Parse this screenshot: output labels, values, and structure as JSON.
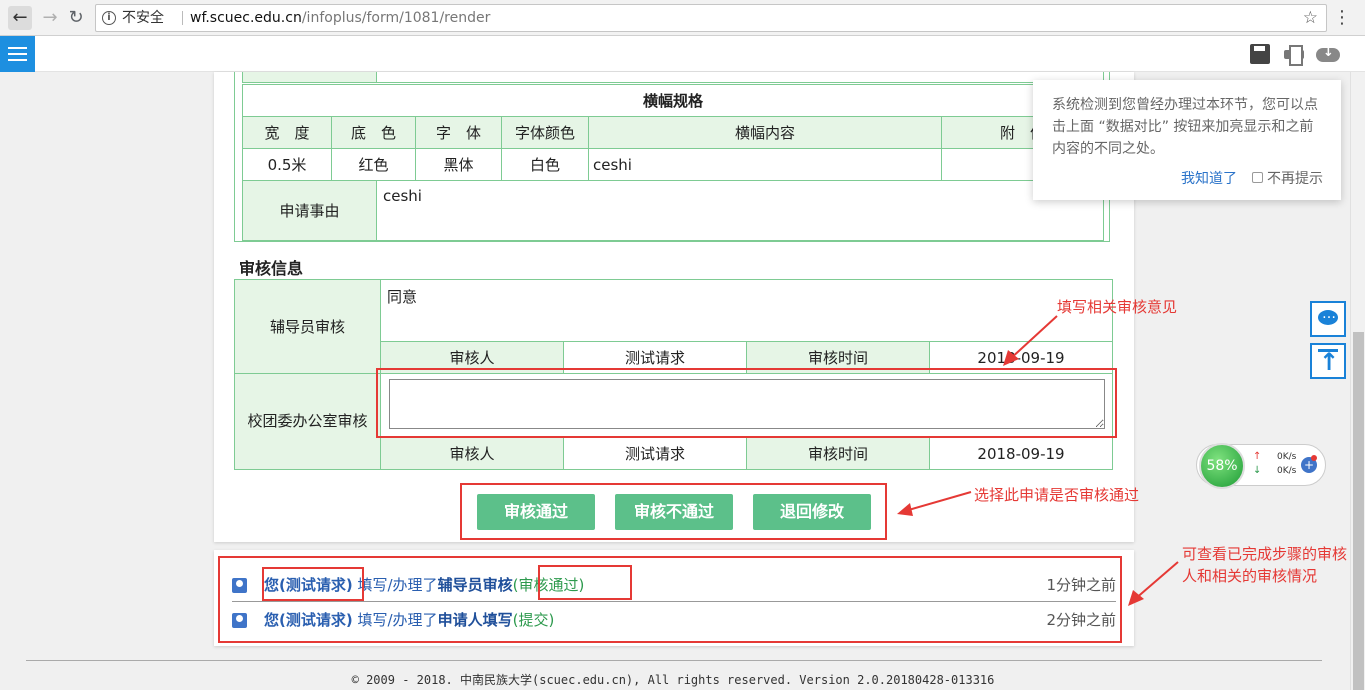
{
  "browser": {
    "insecure_label": "不安全",
    "url_host": "wf.scuec.edu.cn",
    "url_path": "/infoplus/form/1081/render"
  },
  "banner_section": {
    "title": "横幅规格",
    "headers": [
      "宽　度",
      "底　色",
      "字　体",
      "字体颜色",
      "横幅内容",
      "附　件"
    ],
    "values": [
      "0.5米",
      "红色",
      "黑体",
      "白色",
      "ceshi",
      ""
    ]
  },
  "reason": {
    "label": "申请事由",
    "value": "ceshi"
  },
  "review": {
    "section_title": "审核信息",
    "counselor": {
      "label": "辅导员审核",
      "opinion": "同意",
      "reviewer_label": "审核人",
      "reviewer_value": "测试请求",
      "time_label": "审核时间",
      "time_value": "2018-09-19"
    },
    "league": {
      "label": "校团委办公室审核",
      "opinion": "",
      "reviewer_label": "审核人",
      "reviewer_value": "测试请求",
      "time_label": "审核时间",
      "time_value": "2018-09-19"
    }
  },
  "actions": {
    "approve": "审核通过",
    "reject": "审核不通过",
    "return": "退回修改"
  },
  "annotations": {
    "fill_opinion": "填写相关审核意见",
    "choose_result": "选择此申请是否审核通过",
    "view_history": "可查看已完成步骤的审核人和相关的审核情况"
  },
  "history": [
    {
      "user": "您(测试请求)",
      "middle": "填写/办理了",
      "step": "辅导员审核",
      "result_open": "(",
      "result": "审核通过",
      "result_close": ")",
      "time": "1分钟之前"
    },
    {
      "user": "您(测试请求)",
      "middle": "填写/办理了",
      "step": "申请人填写",
      "result_open": "(",
      "result": "提交",
      "result_close": ")",
      "time": "2分钟之前"
    }
  ],
  "footer": "© 2009 - 2018. 中南民族大学(scuec.edu.cn), All rights reserved. Version 2.0.20180428-013316",
  "tooltip": {
    "message": "系统检测到您曾经办理过本环节，您可以点击上面 “数据对比” 按钮来加亮显示和之前内容的不同之处。",
    "ok": "我知道了",
    "no_more": "不再提示"
  },
  "speed_widget": {
    "percent": "58%",
    "up": "0K/s",
    "down": "0K/s"
  }
}
